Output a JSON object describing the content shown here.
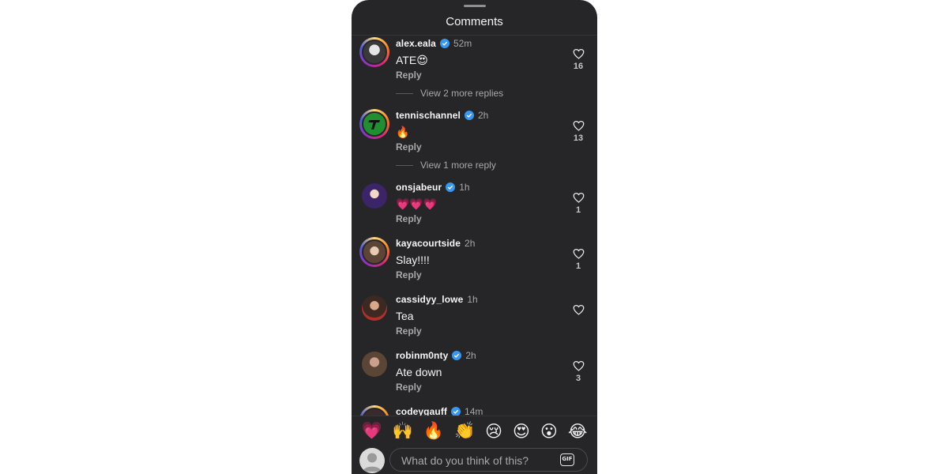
{
  "header": {
    "title": "Comments"
  },
  "comments": [
    {
      "username": "alex.eala",
      "verified": true,
      "time": "52m",
      "text": "ATE😍",
      "reply_label": "Reply",
      "likes": "16",
      "more_replies": "View 2 more replies"
    },
    {
      "username": "tennischannel",
      "verified": true,
      "time": "2h",
      "text": "🔥",
      "reply_label": "Reply",
      "likes": "13",
      "more_replies": "View 1 more reply"
    },
    {
      "username": "onsjabeur",
      "verified": true,
      "time": "1h",
      "text": "💗💗💗",
      "reply_label": "Reply",
      "likes": "1"
    },
    {
      "username": "kayacourtside",
      "verified": false,
      "time": "2h",
      "text": "Slay!!!!",
      "reply_label": "Reply",
      "likes": "1"
    },
    {
      "username": "cassidyy_lowe",
      "verified": false,
      "time": "1h",
      "text": "Tea",
      "reply_label": "Reply",
      "likes": ""
    },
    {
      "username": "robinm0nty",
      "verified": true,
      "time": "2h",
      "text": "Ate down",
      "reply_label": "Reply",
      "likes": "3"
    },
    {
      "username": "codeygauff",
      "verified": true,
      "time": "14m"
    }
  ],
  "emoji_bar": [
    "💗",
    "🙌",
    "🔥",
    "👏",
    "😢",
    "😍",
    "😮",
    "😂"
  ],
  "composer": {
    "placeholder": "What do you think of this?",
    "gif_label": "GIF"
  },
  "colors": {
    "background": "#262628",
    "verified": "#3897f0",
    "muted_text": "#a8a8a8"
  }
}
